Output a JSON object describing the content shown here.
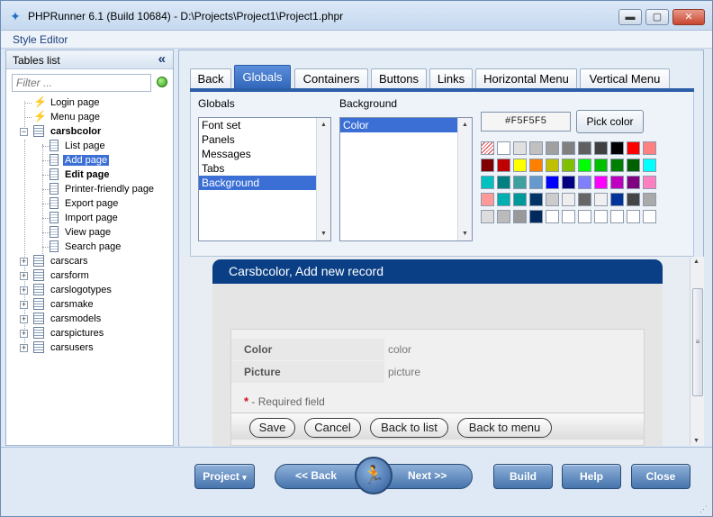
{
  "window": {
    "title": "PHPRunner 6.1 (Build 10684) - D:\\Projects\\Project1\\Project1.phpr",
    "app_icon": "runner-icon",
    "minimize": "▬",
    "maximize": "▢",
    "close": "✕"
  },
  "menu": {
    "style_editor": "Style Editor"
  },
  "left": {
    "header": "Tables list",
    "collapse_glyph": "«",
    "filter_placeholder": "Filter ...",
    "tree": [
      {
        "label": "Login page",
        "icon": "bolt-icon"
      },
      {
        "label": "Menu page",
        "icon": "bolt-icon"
      },
      {
        "label": "carsbcolor",
        "icon": "table-icon"
      },
      {
        "label": "List page",
        "icon": "page-icon"
      },
      {
        "label": "Add page",
        "icon": "add-page-icon"
      },
      {
        "label": "Edit page",
        "icon": "edit-page-icon"
      },
      {
        "label": "Printer-friendly page",
        "icon": "printer-icon"
      },
      {
        "label": "Export page",
        "icon": "export-icon"
      },
      {
        "label": "Import page",
        "icon": "import-icon"
      },
      {
        "label": "View page",
        "icon": "view-icon"
      },
      {
        "label": "Search page",
        "icon": "page-icon"
      },
      {
        "label": "carscars",
        "icon": "table-icon"
      },
      {
        "label": "carsform",
        "icon": "table-icon"
      },
      {
        "label": "carslogotypes",
        "icon": "table-icon"
      },
      {
        "label": "carsmake",
        "icon": "table-icon"
      },
      {
        "label": "carsmodels",
        "icon": "table-icon"
      },
      {
        "label": "carspictures",
        "icon": "table-icon"
      },
      {
        "label": "carsusers",
        "icon": "table-icon"
      }
    ]
  },
  "tabs": [
    "Back",
    "Globals",
    "Containers",
    "Buttons",
    "Links",
    "Horizontal Menu",
    "Vertical Menu"
  ],
  "globals": {
    "label": "Globals",
    "items": [
      "Font set",
      "Panels",
      "Messages",
      "Tabs",
      "Background"
    ],
    "selected": "Background"
  },
  "background": {
    "label": "Background",
    "items": [
      "Color"
    ],
    "selected": "Color"
  },
  "color": {
    "value": "#F5F5F5",
    "pick_label": "Pick color",
    "swatches": [
      [
        "none",
        "#ffffff",
        "#e0e0e0",
        "#c0c0c0",
        "#a0a0a0",
        "#808080",
        "#606060",
        "#404040",
        "#000000",
        "#ff0000",
        "#ff8080"
      ],
      [
        "#800000",
        "#c00000",
        "#ffff00",
        "#ff8000",
        "#c0c000",
        "#80c000",
        "#00ff00",
        "#00c000",
        "#008000",
        "#006000",
        "#00ffff"
      ],
      [
        "#00c0c0",
        "#008080",
        "#40a0a0",
        "#6699cc",
        "#0000ff",
        "#000080",
        "#8080ff",
        "#ff00ff",
        "#c000c0",
        "#800080",
        "#ff80c0"
      ],
      [
        "#ff9999",
        "#00b0b0",
        "#009999",
        "#003366",
        "#cccccc",
        "#eeeeee",
        "#666666",
        "#f0f0f0",
        "#003399",
        "#444444",
        "#aaaaaa"
      ],
      [
        "#dddddd",
        "#bbbbbb",
        "#999999",
        "#002a5e",
        "#ffffff",
        "#ffffff",
        "#ffffff",
        "#ffffff",
        "#ffffff",
        "#ffffff",
        "#ffffff"
      ]
    ]
  },
  "preview": {
    "header": "Carsbcolor, Add new record",
    "fields": [
      {
        "label": "Color",
        "value": "color"
      },
      {
        "label": "Picture",
        "value": "picture"
      }
    ],
    "required_star": "*",
    "required_text": " - Required field",
    "buttons": [
      "Save",
      "Cancel",
      "Back to list",
      "Back to menu"
    ],
    "scroll_grip": "≡"
  },
  "footer": {
    "project": "Project",
    "project_arrow": "▾",
    "back": "<< Back",
    "next": "Next >>",
    "run_glyph": "🏃",
    "build": "Build",
    "help": "Help",
    "close": "Close"
  }
}
